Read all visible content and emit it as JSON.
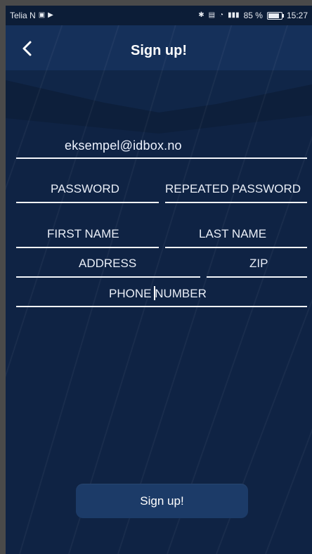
{
  "status_bar": {
    "carrier": "Telia N",
    "battery_percent": "85 %",
    "time": "15:27"
  },
  "header": {
    "title": "Sign up!"
  },
  "form": {
    "email_value": "eksempel@idbox.no",
    "password_placeholder": "PASSWORD",
    "repeated_password_placeholder": "REPEATED PASSWORD",
    "first_name_placeholder": "FIRST NAME",
    "last_name_placeholder": "LAST NAME",
    "address_placeholder": "ADDRESS",
    "zip_placeholder": "ZIP",
    "phone_placeholder_part1": "PHONE ",
    "phone_placeholder_part2": "NUMBER"
  },
  "actions": {
    "signup_label": "Sign up!"
  },
  "colors": {
    "background": "#0f2344",
    "header": "#13284a",
    "button": "#1c3b68",
    "text": "#ffffff",
    "line": "#f3f6fb"
  },
  "icons": [
    "back-arrow-icon",
    "media-icon",
    "play-icon",
    "bluetooth-icon",
    "volte-icon",
    "wifi-icon",
    "signal-icon",
    "battery-icon"
  ]
}
